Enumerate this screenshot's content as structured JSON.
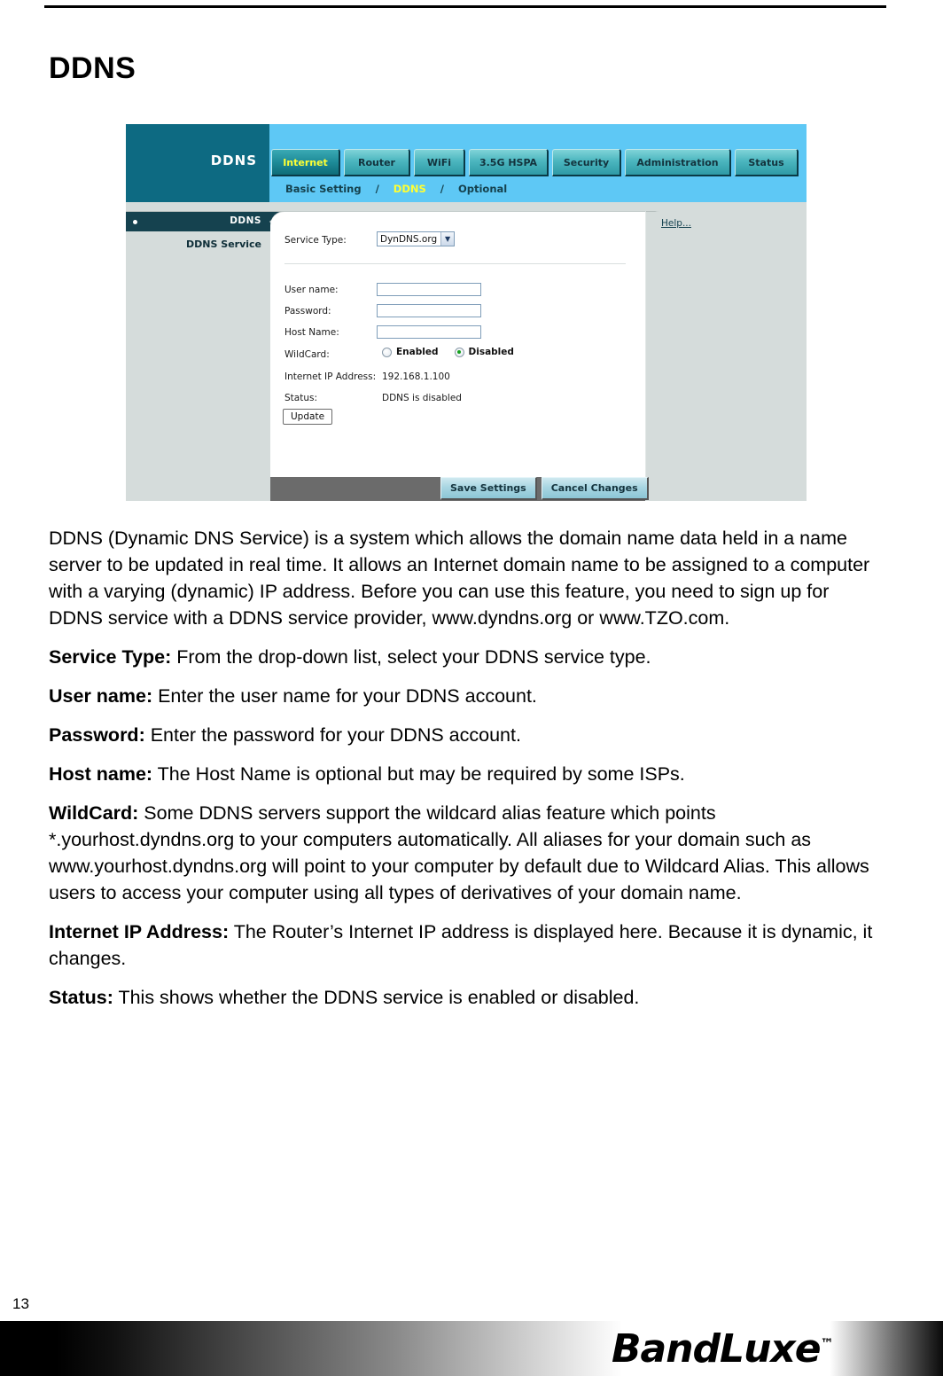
{
  "page": {
    "title": "DDNS",
    "number": "13",
    "footer_logo": "BandLuxe",
    "footer_logo_tm": "™"
  },
  "screenshot": {
    "brand_label": "DDNS",
    "tabs": [
      {
        "label": "Internet",
        "active": true
      },
      {
        "label": "Router",
        "active": false
      },
      {
        "label": "WiFi",
        "active": false
      },
      {
        "label": "3.5G HSPA",
        "active": false
      },
      {
        "label": "Security",
        "active": false
      },
      {
        "label": "Administration",
        "active": false
      },
      {
        "label": "Status",
        "active": false
      }
    ],
    "subnav": {
      "item1": "Basic Setting",
      "sep1": "/",
      "item2": "DDNS",
      "sep2": "/",
      "item3": "Optional"
    },
    "sidebar": {
      "header": "DDNS",
      "item": "DDNS Service"
    },
    "form": {
      "service_type_label": "Service Type:",
      "service_type_value": "DynDNS.org",
      "username_label": "User name:",
      "username_value": "",
      "password_label": "Password:",
      "password_value": "",
      "hostname_label": "Host Name:",
      "hostname_value": "",
      "wildcard_label": "WildCard:",
      "wildcard_enabled_label": "Enabled",
      "wildcard_disabled_label": "Disabled",
      "wildcard_selected": "Disabled",
      "internet_ip_label": "Internet IP Address:",
      "internet_ip_value": "192.168.1.100",
      "status_label": "Status:",
      "status_value": "DDNS is disabled",
      "update_button": "Update"
    },
    "help": {
      "link": "Help..."
    },
    "footer_buttons": {
      "save": "Save Settings",
      "cancel": "Cancel Changes"
    },
    "colors": {
      "brand_teal": "#0d6a82",
      "header_blue": "#5ec8f5",
      "tab_teal": "#4cb6bf",
      "active_tab_text": "#ffff33",
      "sidebar_header": "#15424f",
      "panel_gray": "#d5dcdb",
      "radio_dot_green": "#15a01e"
    }
  },
  "body": {
    "intro": "DDNS (Dynamic DNS Service) is a system which allows the domain name data held in a name server to be updated in real time. It allows an Internet domain name to be assigned to a computer with a varying (dynamic) IP address. Before you can use this feature, you need to sign up for DDNS service with a DDNS service provider, www.dyndns.org or www.TZO.com.",
    "entries": [
      {
        "term": "Service Type:",
        "desc": " From the drop-down list, select your DDNS service type."
      },
      {
        "term": "User name:",
        "desc": " Enter the user name for your DDNS account."
      },
      {
        "term": "Password:",
        "desc": " Enter the password for your DDNS account."
      },
      {
        "term": "Host name:",
        "desc": " The Host Name is optional but may be required by some ISPs."
      },
      {
        "term": "WildCard:",
        "desc": " Some DDNS servers support the wildcard alias feature which points *.yourhost.dyndns.org to your computers automatically. All aliases for your domain such as www.yourhost.dyndns.org will point to your computer by default due to Wildcard Alias. This allows users to access your computer using all types of derivatives of your domain name."
      },
      {
        "term": "Internet IP Address:",
        "desc": " The Router’s Internet IP address is displayed here. Because it is dynamic, it changes."
      },
      {
        "term": "Status:",
        "desc": " This shows whether the DDNS service is enabled or disabled."
      }
    ]
  }
}
